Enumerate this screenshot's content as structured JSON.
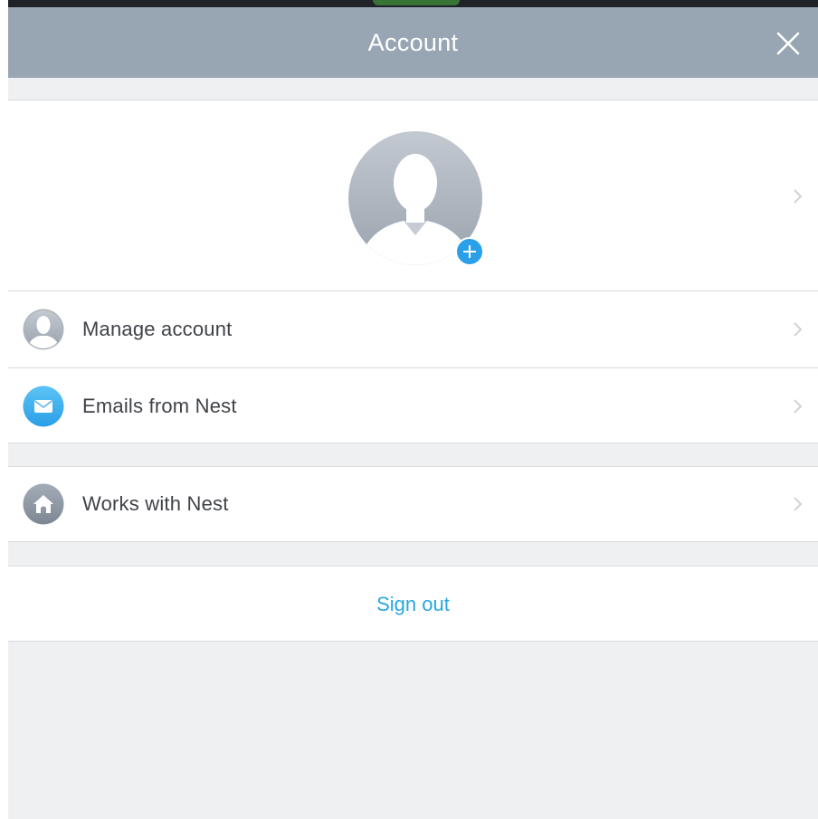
{
  "header": {
    "title": "Account",
    "close_icon": "close-icon"
  },
  "profile": {
    "avatar_icon": "user-avatar-icon",
    "add_icon": "plus-icon"
  },
  "menu": {
    "items": [
      {
        "label": "Manage account",
        "icon": "user-icon"
      },
      {
        "label": "Emails from Nest",
        "icon": "envelope-icon"
      },
      {
        "label": "Works with Nest",
        "icon": "home-icon"
      }
    ]
  },
  "sign_out": {
    "label": "Sign out"
  },
  "colors": {
    "header_bg": "#98a6b3",
    "accent_blue": "#27a7e0",
    "page_bg": "#eff0f2"
  }
}
